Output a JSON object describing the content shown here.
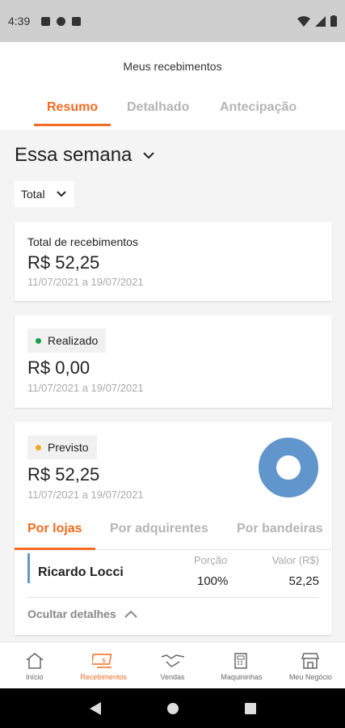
{
  "status_bar": {
    "time": "4:39"
  },
  "header": {
    "title": "Meus recebimentos",
    "tabs": [
      {
        "label": "Resumo",
        "active": true
      },
      {
        "label": "Detalhado",
        "active": false
      },
      {
        "label": "Antecipação",
        "active": false
      }
    ]
  },
  "period_selector": {
    "label": "Essa semana"
  },
  "filter": {
    "value": "Total"
  },
  "total_card": {
    "label": "Total de recebimentos",
    "amount": "R$ 52,25",
    "period": "11/07/2021 a 19/07/2021"
  },
  "realizado_card": {
    "badge": "Realizado",
    "dot_color": "#1a9e4b",
    "amount": "R$ 0,00",
    "period": "11/07/2021 a 19/07/2021"
  },
  "previsto_card": {
    "badge": "Previsto",
    "dot_color": "#f5a623",
    "amount": "R$ 52,25",
    "period": "11/07/2021 a 19/07/2021",
    "donut_color": "#6196cc",
    "subtabs": [
      {
        "label": "Por lojas",
        "active": true
      },
      {
        "label": "Por adquirentes",
        "active": false
      },
      {
        "label": "Por bandeiras",
        "active": false
      }
    ],
    "table": {
      "col_porcao": "Porção",
      "col_valor": "Valor (R$)",
      "rows": [
        {
          "name": "Ricardo Locci",
          "porcao": "100%",
          "valor": "52,25"
        }
      ]
    },
    "toggle_details": "Ocultar detalhes"
  },
  "bottom_nav": [
    {
      "label": "Início",
      "icon": "home-icon",
      "active": false
    },
    {
      "label": "Recebimentos",
      "icon": "money-icon",
      "active": true
    },
    {
      "label": "Vendas",
      "icon": "handshake-icon",
      "active": false
    },
    {
      "label": "Maquininhas",
      "icon": "card-machine-icon",
      "active": false
    },
    {
      "label": "Meu Negócio",
      "icon": "store-icon",
      "active": false
    }
  ],
  "colors": {
    "accent": "#f26b21"
  }
}
